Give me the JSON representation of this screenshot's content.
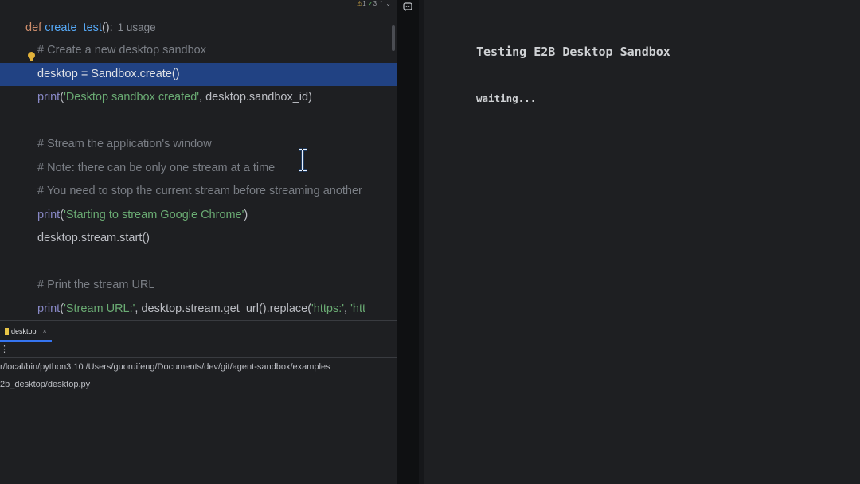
{
  "editor": {
    "inspections": {
      "warnings": "1",
      "checks": "3"
    },
    "lines": {
      "l0": {
        "kw": "def",
        "fn": "create_test",
        "paren": "():",
        "usage": "1 usage"
      },
      "l1": {
        "comment": "# Create a new desktop sandbox"
      },
      "l2": {
        "code": "desktop = Sandbox.create()"
      },
      "l3": {
        "fn": "print",
        "open": "(",
        "str": "'Desktop sandbox created'",
        "rest": ", desktop.sandbox_id)"
      },
      "l5": {
        "comment": "# Stream the application's window"
      },
      "l6": {
        "comment": "# Note: there can be only one stream at a time"
      },
      "l7": {
        "comment": "# You need to stop the current stream before streaming another"
      },
      "l8": {
        "fn": "print",
        "open": "(",
        "str": "'Starting to stream Google Chrome'",
        "rest": ")"
      },
      "l9": {
        "code": "desktop.stream.start()"
      },
      "l11": {
        "comment": "# Print the stream URL"
      },
      "l12": {
        "fn": "print",
        "open": "(",
        "str": "'Stream URL:'",
        "rest": ", desktop.stream.get_url().replace(",
        "str2": "'https:'",
        "rest2": ", ",
        "str3": "'htt"
      }
    }
  },
  "run": {
    "tab_label": "desktop",
    "tab_close": "×",
    "kebab": "⋮",
    "console": [
      "r/local/bin/python3.10 /Users/guoruifeng/Documents/dev/git/agent-sandbox/examples",
      "2b_desktop/desktop.py"
    ]
  },
  "output": {
    "title": "Testing E2B Desktop Sandbox",
    "status": "waiting..."
  },
  "colors": {
    "selection": "#214283",
    "keyword": "#cf8e6d",
    "function": "#56a8f5",
    "string": "#6aab73",
    "comment": "#7a7e85"
  },
  "icons": [
    "lightbulb-icon",
    "warning-icon",
    "check-icon",
    "text-cursor-icon",
    "python-file-icon",
    "close-icon",
    "more-icon",
    "ai-chat-icon"
  ]
}
